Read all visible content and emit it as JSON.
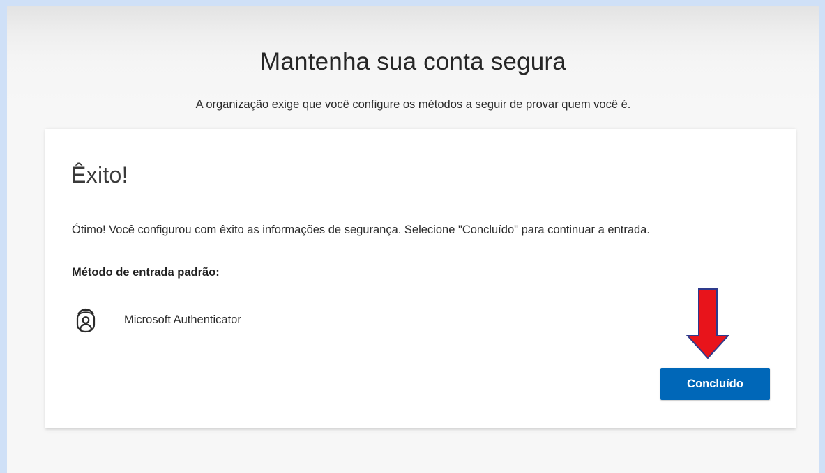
{
  "header": {
    "title": "Mantenha sua conta segura",
    "subtitle": "A organização exige que você configure os métodos a seguir de provar quem você é."
  },
  "card": {
    "title": "Êxito!",
    "message": "Ótimo! Você configurou com êxito as informações de segurança. Selecione \"Concluído\" para continuar a entrada.",
    "default_method_label": "Método de entrada padrão:",
    "method": {
      "name": "Microsoft Authenticator",
      "icon": "authenticator-lock-icon"
    },
    "done_button_label": "Concluído"
  },
  "annotation": {
    "arrow_icon": "red-down-arrow-icon",
    "arrow_color": "#e8141b"
  },
  "colors": {
    "accent": "#0067b8",
    "page_frame": "#cfe0f7",
    "background": "#f7f7f7",
    "card": "#ffffff"
  }
}
